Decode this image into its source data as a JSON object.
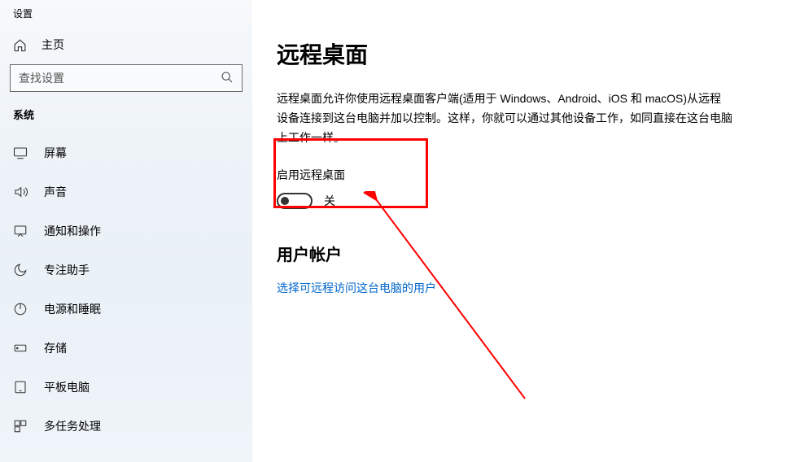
{
  "app_title": "设置",
  "sidebar": {
    "home_label": "主页",
    "search_placeholder": "查找设置",
    "section_label": "系统",
    "items": [
      {
        "label": "屏幕"
      },
      {
        "label": "声音"
      },
      {
        "label": "通知和操作"
      },
      {
        "label": "专注助手"
      },
      {
        "label": "电源和睡眠"
      },
      {
        "label": "存储"
      },
      {
        "label": "平板电脑"
      },
      {
        "label": "多任务处理"
      }
    ]
  },
  "main": {
    "title": "远程桌面",
    "description": "远程桌面允许你使用远程桌面客户端(适用于 Windows、Android、iOS 和 macOS)从远程设备连接到这台电脑并加以控制。这样，你就可以通过其他设备工作，如同直接在这台电脑上工作一样。",
    "enable_label": "启用远程桌面",
    "toggle_state": "关",
    "subsection": "用户帐户",
    "link_text": "选择可远程访问这台电脑的用户"
  }
}
